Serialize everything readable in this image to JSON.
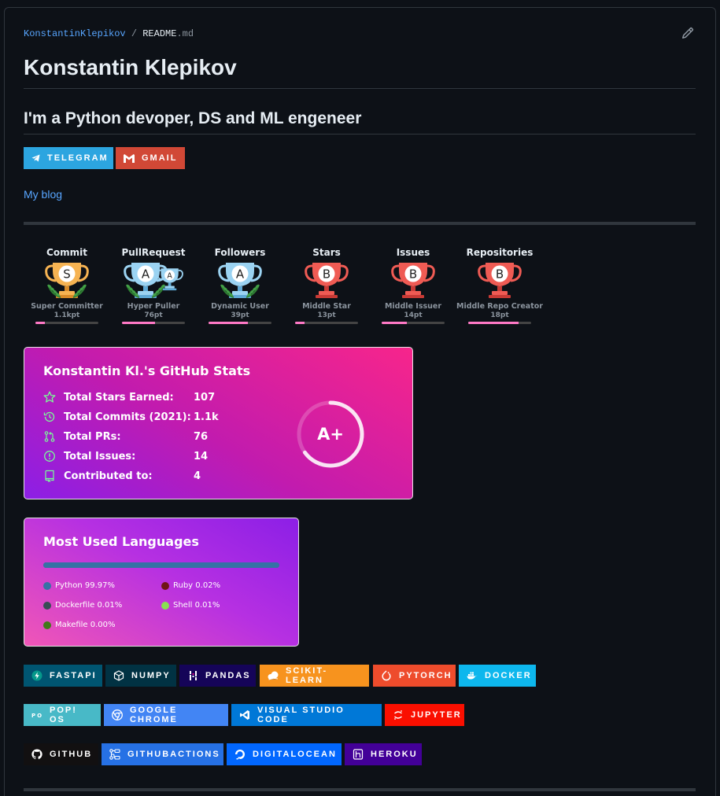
{
  "breadcrumb": {
    "user": "KonstantinKlepikov",
    "sep": "/",
    "file": "README",
    "ext": ".md"
  },
  "title": "Konstantin Klepikov",
  "subtitle": "I'm a Python devoper, DS and ML engeneer",
  "contact_badges": [
    {
      "label": "TELEGRAM",
      "color": "#2ca5e0",
      "icon": "telegram-icon"
    },
    {
      "label": "GMAIL",
      "color": "#d14836",
      "icon": "gmail-icon"
    }
  ],
  "blog_link": "My blog",
  "trophies": [
    {
      "category": "Commit",
      "rank": "S",
      "name": "Super Committer",
      "points": "1.1kpt",
      "progress": 0.15,
      "cup": "gold"
    },
    {
      "category": "PullRequest",
      "rank": "A",
      "name": "Hyper Puller",
      "points": "76pt",
      "progress": 0.52,
      "cup": "silver",
      "extra_rank": "A"
    },
    {
      "category": "Followers",
      "rank": "A",
      "name": "Dynamic User",
      "points": "39pt",
      "progress": 0.62,
      "cup": "silver"
    },
    {
      "category": "Stars",
      "rank": "B",
      "name": "Middle Star",
      "points": "13pt",
      "progress": 0.15,
      "cup": "bronze"
    },
    {
      "category": "Issues",
      "rank": "B",
      "name": "Middle Issuer",
      "points": "14pt",
      "progress": 0.4,
      "cup": "bronze"
    },
    {
      "category": "Repositories",
      "rank": "B",
      "name": "Middle Repo Creator",
      "points": "18pt",
      "progress": 0.8,
      "cup": "bronze"
    }
  ],
  "stats_card": {
    "title": "Konstantin Kl.'s GitHub Stats",
    "rows": [
      {
        "label": "Total Stars Earned:",
        "value": "107",
        "icon": "star-icon"
      },
      {
        "label": "Total Commits (2021):",
        "value": "1.1k",
        "icon": "history-icon"
      },
      {
        "label": "Total PRs:",
        "value": "76",
        "icon": "pull-request-icon"
      },
      {
        "label": "Total Issues:",
        "value": "14",
        "icon": "issue-icon"
      },
      {
        "label": "Contributed to:",
        "value": "4",
        "icon": "repo-icon"
      }
    ],
    "grade": "A+",
    "grade_progress": 0.65
  },
  "languages_card": {
    "title": "Most Used Languages",
    "languages": [
      {
        "name": "Python",
        "percent": "99.97%",
        "share": 99.97,
        "color": "#3572a5"
      },
      {
        "name": "Ruby",
        "percent": "0.02%",
        "share": 0.02,
        "color": "#701516"
      },
      {
        "name": "Dockerfile",
        "percent": "0.01%",
        "share": 0.01,
        "color": "#384d54"
      },
      {
        "name": "Shell",
        "percent": "0.01%",
        "share": 0.01,
        "color": "#89e051"
      },
      {
        "name": "Makefile",
        "percent": "0.00%",
        "share": 0.0,
        "color": "#427819"
      }
    ]
  },
  "tech_badges_row1": [
    {
      "label": "FASTAPI",
      "color": "#005571",
      "icon": "fastapi-icon"
    },
    {
      "label": "NUMPY",
      "color": "#013243",
      "icon": "numpy-icon"
    },
    {
      "label": "PANDAS",
      "color": "#150458",
      "icon": "pandas-icon"
    },
    {
      "label": "SCIKIT-LEARN",
      "color": "#f7931e",
      "icon": "scikit-learn-icon"
    },
    {
      "label": "PYTORCH",
      "color": "#ee4c2c",
      "icon": "pytorch-icon"
    },
    {
      "label": "DOCKER",
      "color": "#0db7ed",
      "icon": "docker-icon"
    }
  ],
  "tech_badges_row2": [
    {
      "label": "POP! OS",
      "color": "#48b9c7",
      "icon": "popos-icon"
    },
    {
      "label": "GOOGLE CHROME",
      "color": "#4285f4",
      "icon": "chrome-icon"
    },
    {
      "label": "VISUAL STUDIO CODE",
      "color": "#0078d7",
      "icon": "vscode-icon"
    },
    {
      "label": "JUPYTER",
      "color": "#fa0f00",
      "icon": "jupyter-icon"
    }
  ],
  "tech_badges_row3": [
    {
      "label": "GITHUB",
      "color": "#121011",
      "icon": "github-icon"
    },
    {
      "label": "GITHUBACTIONS",
      "color": "#2671e5",
      "icon": "github-actions-icon"
    },
    {
      "label": "DIGITALOCEAN",
      "color": "#0167ff",
      "icon": "digitalocean-icon"
    },
    {
      "label": "HEROKU",
      "color": "#430098",
      "icon": "heroku-icon"
    }
  ]
}
